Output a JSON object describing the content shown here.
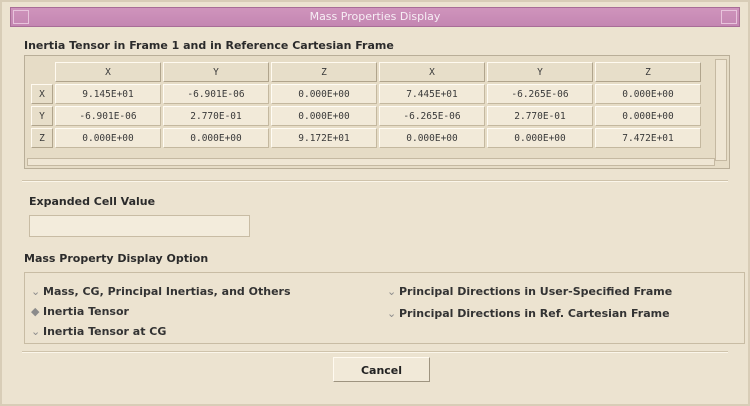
{
  "window": {
    "title": "Mass Properties Display"
  },
  "tensor": {
    "section_title": "Inertia Tensor in Frame 1 and in Reference Cartesian Frame",
    "headers": [
      "X",
      "Y",
      "Z",
      "X",
      "Y",
      "Z"
    ],
    "row_labels": [
      "X",
      "Y",
      "Z"
    ],
    "rows": [
      [
        "9.145E+01",
        "-6.901E-06",
        "0.000E+00",
        "7.445E+01",
        "-6.265E-06",
        "0.000E+00"
      ],
      [
        "-6.901E-06",
        "2.770E-01",
        "0.000E+00",
        "-6.265E-06",
        "2.770E-01",
        "0.000E+00"
      ],
      [
        "0.000E+00",
        "0.000E+00",
        "9.172E+01",
        "0.000E+00",
        "0.000E+00",
        "7.472E+01"
      ]
    ]
  },
  "expanded": {
    "label": "Expanded Cell Value",
    "value": ""
  },
  "display_option": {
    "label": "Mass Property Display Option",
    "options": [
      {
        "label": "Mass, CG, Principal Inertias, and Others",
        "selected": false
      },
      {
        "label": "Inertia Tensor",
        "selected": true
      },
      {
        "label": "Inertia Tensor at CG",
        "selected": false
      },
      {
        "label": "Principal Directions in User-Specified Frame",
        "selected": false
      },
      {
        "label": "Principal Directions in Ref. Cartesian Frame",
        "selected": false
      }
    ]
  },
  "buttons": {
    "cancel": "Cancel"
  },
  "colors": {
    "titlebar": "#c486b2",
    "background": "#ece3d0"
  }
}
